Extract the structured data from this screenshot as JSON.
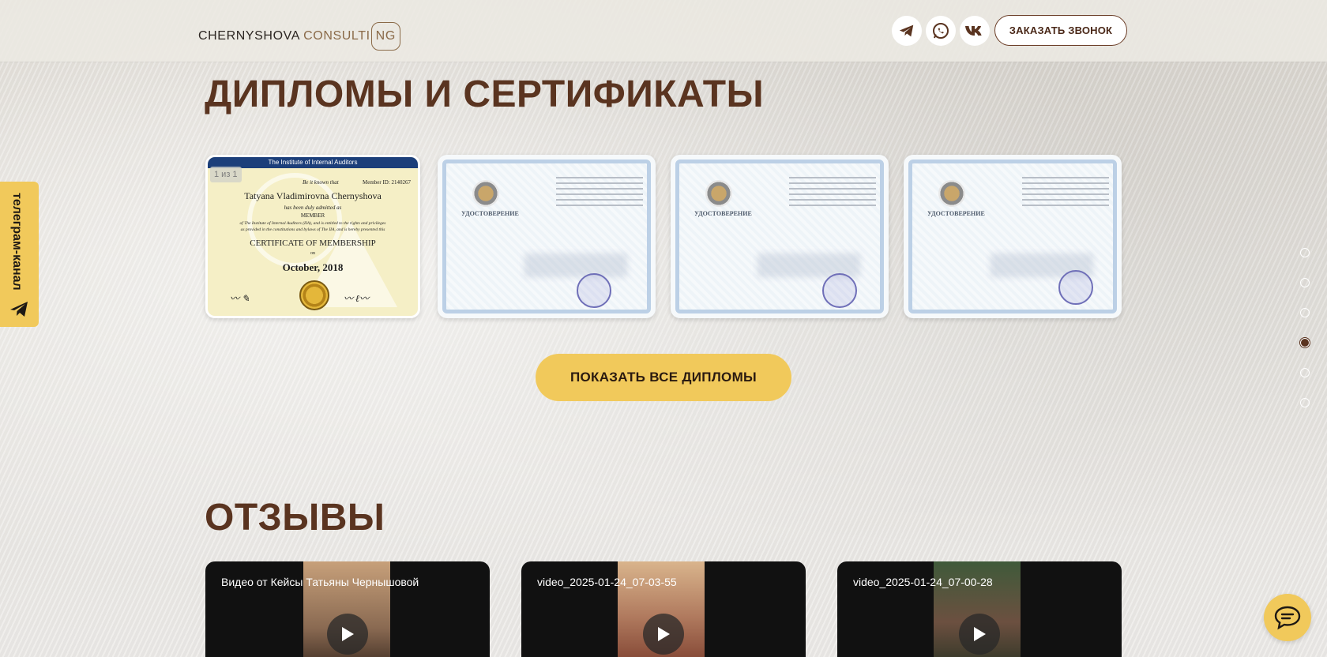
{
  "header": {
    "logo_part1": "CHERNYSHOVA ",
    "logo_part2": "CONSULTI",
    "logo_part3": "NG",
    "socials": [
      "telegram-icon",
      "whatsapp-icon",
      "vk-icon"
    ],
    "call_button": "ЗАКАЗАТЬ ЗВОНОК"
  },
  "side_tab": {
    "label": "телеграм-канал"
  },
  "diplomas": {
    "title": "ДИПЛОМЫ И СЕРТИФИКАТЫ",
    "cert1": {
      "counter": "1 из 1",
      "org": "The Institute of Internal Auditors",
      "be_it_known": "Be it known that",
      "member_id": "Member ID: 2140267",
      "name": "Tatyana Vladimirovna Chernyshova",
      "admitted": "has been duly admitted as",
      "member": "MEMBER",
      "body_line1": "of The Institute of Internal Auditors (IIA), and is entitled to the rights and privileges",
      "body_line2": "as provided in the constitutions and bylaws of The IIA, and is hereby presented this",
      "cert_title": "CERTIFICATE OF MEMBERSHIP",
      "on": "on",
      "date": "October, 2018"
    },
    "udost_label": "УДОСТОВЕРЕНИЕ",
    "show_all_button": "ПОКАЗАТЬ ВСЕ ДИПЛОМЫ"
  },
  "reviews": {
    "title": "ОТЗЫВЫ",
    "videos": [
      {
        "title": "Видео от Кейсы Татьяны Чернышовой"
      },
      {
        "title": "video_2025-01-24_07-03-55"
      },
      {
        "title": "video_2025-01-24_07-00-28"
      }
    ]
  },
  "colors": {
    "accent": "#f1c95b",
    "brand_brown": "#5a3420"
  }
}
